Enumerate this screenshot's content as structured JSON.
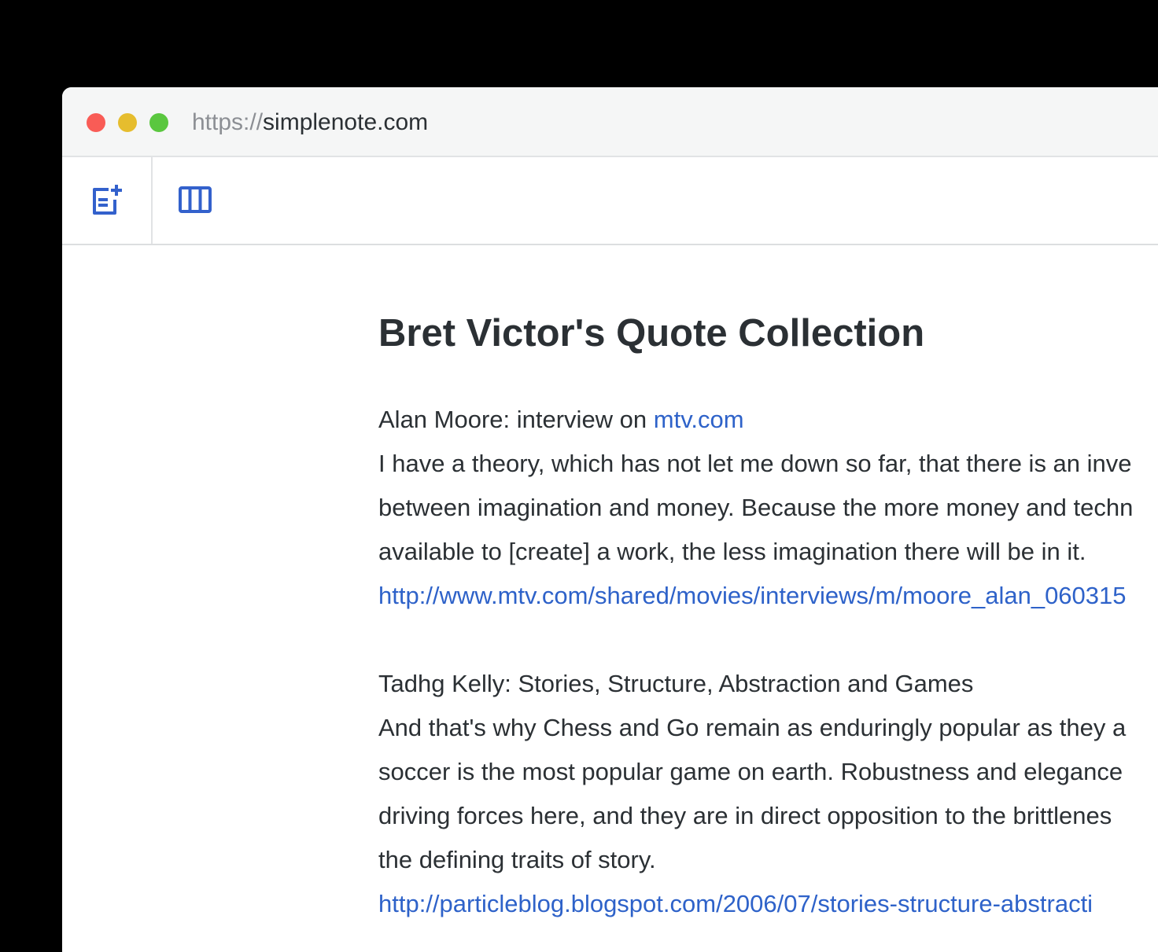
{
  "browser": {
    "url_scheme": "https://",
    "url_host": "simplenote.com",
    "traffic_lights": {
      "close_color": "#f95c56",
      "minimize_color": "#e6bd2e",
      "maximize_color": "#5ac73f"
    }
  },
  "toolbar": {
    "new_note_icon": "new-note-icon",
    "toggle_sidebar_icon": "columns-icon",
    "accent_color": "#3361cc"
  },
  "note": {
    "title": "Bret Victor's Quote Collection",
    "entries": [
      {
        "source_prefix": "Alan Moore: interview on ",
        "source_link": "mtv.com",
        "quote_lines": [
          "I have a theory, which has not let me down so far, that there is an inve",
          "between imagination and money. Because the more money and techn",
          "available to [create] a work, the less imagination there will be in it."
        ],
        "url": "http://www.mtv.com/shared/movies/interviews/m/moore_alan_060315"
      },
      {
        "source": "Tadhg Kelly: Stories, Structure, Abstraction and Games",
        "quote_lines": [
          "And that's why Chess and Go remain as enduringly popular as they a",
          "soccer is the most popular game on earth. Robustness and elegance",
          "driving forces here, and they are in direct opposition to the brittlenes",
          "the defining traits of story."
        ],
        "url": "http://particleblog.blogspot.com/2006/07/stories-structure-abstracti"
      }
    ]
  }
}
